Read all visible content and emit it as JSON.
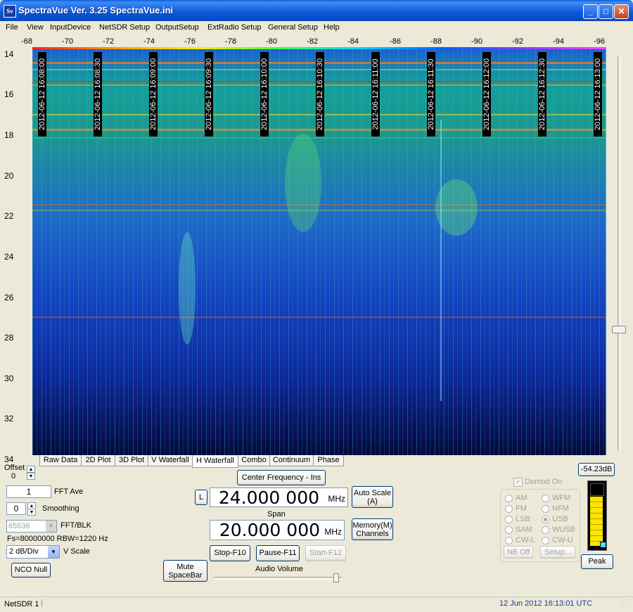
{
  "window": {
    "title": "SpectraVue Ver. 3.25  SpectraVue.ini",
    "icon_text": "Sv",
    "min": "_",
    "max": "□",
    "close": "✕"
  },
  "menu": [
    "File",
    "View",
    "InputDevice",
    "NetSDR Setup",
    "OutputSetup",
    "ExtRadio Setup",
    "General Setup",
    "Help"
  ],
  "x_axis_ticks": [
    "-68",
    "-70",
    "-72",
    "-74",
    "-76",
    "-78",
    "-80",
    "-82",
    "-84",
    "-86",
    "-88",
    "-90",
    "-92",
    "-94",
    "-96"
  ],
  "y_axis_ticks": [
    "14",
    "16",
    "18",
    "20",
    "22",
    "24",
    "26",
    "28",
    "30",
    "32",
    "34"
  ],
  "time_stamps": [
    "2012-06-12 16:08:00",
    "2012-06-12 16:08:30",
    "2012-06-12 16:09:00",
    "2012-06-12 16:09:30",
    "2012-06-12 16:10:00",
    "2012-06-12 16:10:30",
    "2012-06-12 16:11:00",
    "2012-06-12 16:11:30",
    "2012-06-12 16:12:00",
    "2012-06-12 16:12:30",
    "2012-06-12 16:13:00"
  ],
  "tabs": [
    "Raw Data",
    "2D Plot",
    "3D Plot",
    "V Waterfall",
    "H Waterfall",
    "Combo",
    "Continuum",
    "Phase"
  ],
  "active_tab": "H Waterfall",
  "offset": {
    "label": "Offset",
    "value": "0"
  },
  "fft_ave": {
    "value": "1",
    "label": "FFT Ave"
  },
  "smoothing": {
    "value": "0",
    "label": "Smoothing"
  },
  "fft_blk": {
    "value": "65536",
    "label": "FFT/BLK"
  },
  "fs_info": "Fs=80000000 RBW=1220 Hz",
  "vscale": {
    "value": "2 dB/Div",
    "label": "V Scale"
  },
  "nco_null": "NCO Null",
  "center_freq_button": "Center Frequency - Ins",
  "l_button": "L",
  "center_freq": {
    "value": "24.000 000",
    "unit": "MHz"
  },
  "auto_scale": "Auto Scale\n(A)",
  "span": {
    "label": "Span",
    "value": "20.000 000",
    "unit": "MHz"
  },
  "memory": "Memory(M)\nChannels",
  "stop": "Stop-F10",
  "pause": "Pause-F11",
  "start": "Start-F12",
  "mute": "Mute\nSpaceBar",
  "audio_volume": "Audio Volume",
  "level_readout": "-54.23dB",
  "demod": {
    "label": "Demod On",
    "checked": true,
    "modes": [
      "AM",
      "WFM",
      "FM",
      "NFM",
      "LSB",
      "USB",
      "SAM",
      "WUSB",
      "CW-L",
      "CW-U"
    ],
    "selected": "USB"
  },
  "nb_off": "NB Off",
  "setup": "Setup...",
  "peak": "Peak",
  "status": {
    "device": "NetSDR 1",
    "datetime": "12 Jun 2012  16:13:01 UTC"
  }
}
